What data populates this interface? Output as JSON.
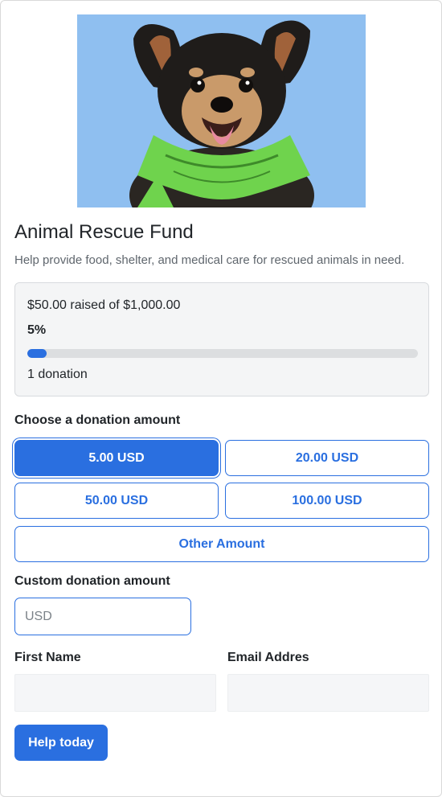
{
  "campaign": {
    "title": "Animal Rescue Fund",
    "description": "Help provide food, shelter, and medical care for rescued animals in need."
  },
  "progress": {
    "raised_text": "$50.00 raised of $1,000.00",
    "percent_text": "5%",
    "percent_value": 5,
    "donations_text": "1 donation"
  },
  "donation": {
    "choose_label": "Choose a donation amount",
    "amounts": [
      {
        "label": "5.00 USD",
        "selected": true
      },
      {
        "label": "20.00 USD",
        "selected": false
      },
      {
        "label": "50.00 USD",
        "selected": false
      },
      {
        "label": "100.00 USD",
        "selected": false
      }
    ],
    "other_label": "Other Amount",
    "custom_label": "Custom donation amount",
    "custom_placeholder": "USD",
    "custom_value": ""
  },
  "form": {
    "first_name_label": "First Name",
    "first_name_value": "",
    "email_label": "Email Addres",
    "email_value": "",
    "submit_label": "Help today"
  },
  "colors": {
    "accent": "#2a6fe0",
    "progress_track": "#dcdee0",
    "panel_bg": "#f4f5f6",
    "sky": "#8fbff0",
    "bandana": "#6fd34d"
  },
  "hero_image": {
    "icon": "dog-photo"
  }
}
